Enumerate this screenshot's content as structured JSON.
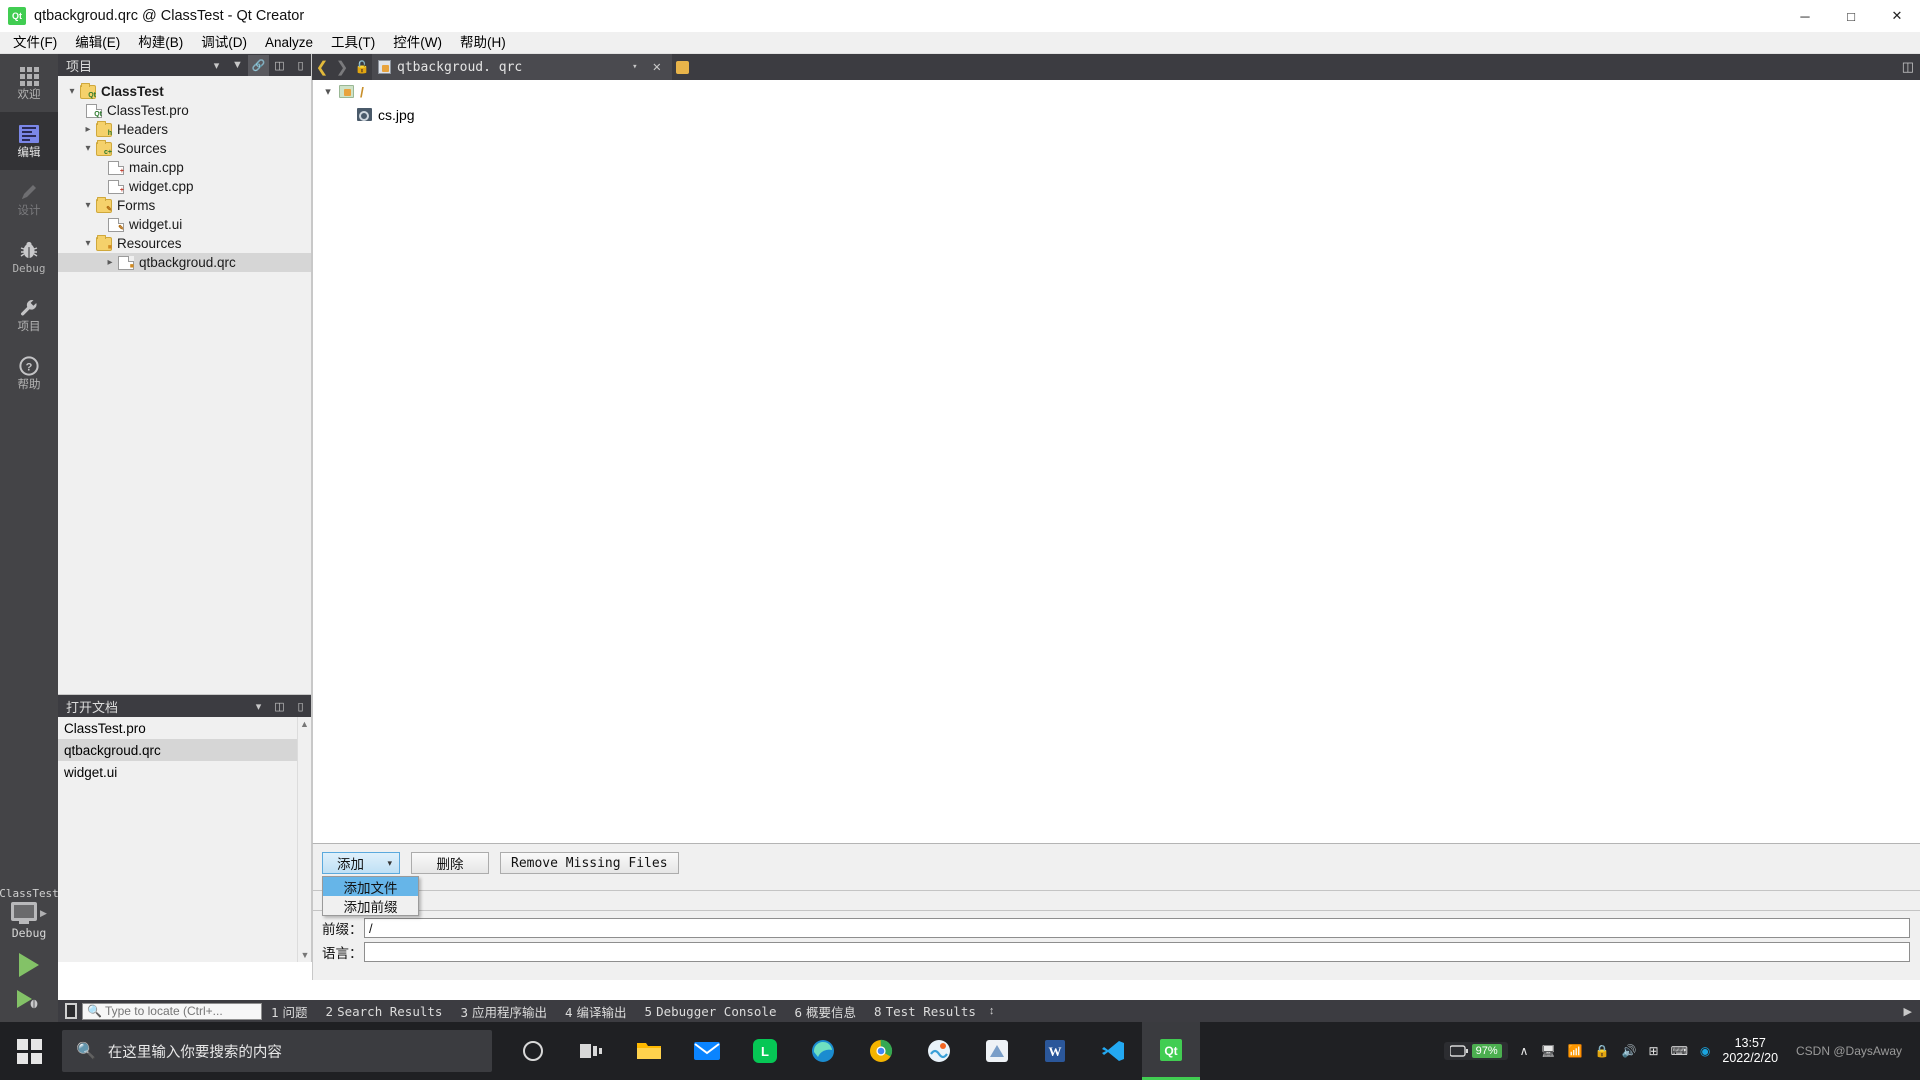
{
  "window": {
    "title": "qtbackgroud.qrc @ ClassTest - Qt Creator",
    "app_icon": "qt-icon",
    "minimize": "─",
    "maximize": "□",
    "close": "✕"
  },
  "menubar": {
    "items": [
      {
        "label": "文件(F)",
        "mnemonic": "F"
      },
      {
        "label": "编辑(E)",
        "mnemonic": "E"
      },
      {
        "label": "构建(B)",
        "mnemonic": "B"
      },
      {
        "label": "调试(D)",
        "mnemonic": "D"
      },
      {
        "label": "Analyze",
        "mnemonic": "A"
      },
      {
        "label": "工具(T)",
        "mnemonic": "T"
      },
      {
        "label": "控件(W)",
        "mnemonic": "W"
      },
      {
        "label": "帮助(H)",
        "mnemonic": "H"
      }
    ]
  },
  "modebar": {
    "items": [
      {
        "label": "欢迎",
        "icon": "grid-icon",
        "state": "normal"
      },
      {
        "label": "编辑",
        "icon": "editor-icon",
        "state": "selected"
      },
      {
        "label": "设计",
        "icon": "pencil-icon",
        "state": "disabled"
      },
      {
        "label": "Debug",
        "icon": "bug-icon",
        "state": "normal"
      },
      {
        "label": "项目",
        "icon": "wrench-icon",
        "state": "normal"
      },
      {
        "label": "帮助",
        "icon": "question-icon",
        "state": "normal"
      }
    ]
  },
  "kit_selector": {
    "project": "ClassTest",
    "build_config": "Debug",
    "run_label": "run-button",
    "debug_label": "debug-button",
    "build_label": "build-button"
  },
  "project_panel": {
    "title": "项目",
    "tree": [
      {
        "label": "ClassTest",
        "icon": "qt-project-icon",
        "indent": 0,
        "chevron": "down",
        "bold": true
      },
      {
        "label": "ClassTest.pro",
        "icon": "pro-file-icon",
        "indent": 1,
        "chevron": "none"
      },
      {
        "label": "Headers",
        "icon": "folder-h-icon",
        "indent": 1,
        "chevron": "right"
      },
      {
        "label": "Sources",
        "icon": "folder-cpp-icon",
        "indent": 1,
        "chevron": "down"
      },
      {
        "label": "main.cpp",
        "icon": "cpp-file-icon",
        "indent": 2,
        "chevron": "none"
      },
      {
        "label": "widget.cpp",
        "icon": "cpp-file-icon",
        "indent": 2,
        "chevron": "none"
      },
      {
        "label": "Forms",
        "icon": "folder-ui-icon",
        "indent": 1,
        "chevron": "down"
      },
      {
        "label": "widget.ui",
        "icon": "ui-file-icon",
        "indent": 2,
        "chevron": "none"
      },
      {
        "label": "Resources",
        "icon": "folder-qrc-icon",
        "indent": 1,
        "chevron": "down"
      },
      {
        "label": "qtbackgroud.qrc",
        "icon": "qrc-file-icon",
        "indent": 2,
        "chevron": "right",
        "selected": true
      }
    ]
  },
  "open_documents": {
    "title": "打开文档",
    "items": [
      {
        "label": "ClassTest.pro",
        "selected": false
      },
      {
        "label": "qtbackgroud.qrc",
        "selected": true
      },
      {
        "label": "widget.ui",
        "selected": false
      }
    ]
  },
  "editor_tabbar": {
    "back": "❮",
    "forward": "❯",
    "lock_icon": "unlocked-icon",
    "tab": {
      "label": "qtbackgroud. qrc",
      "icon": "qrc-file-icon"
    },
    "dropdown": "▾",
    "close": "✕",
    "split_icon": "split-editor-icon"
  },
  "resource_editor": {
    "rows": [
      {
        "label": "/",
        "icon": "prefix-folder-icon",
        "indent": 0,
        "chevron": "down"
      },
      {
        "label": "cs.jpg",
        "icon": "image-file-icon",
        "indent": 1,
        "chevron": "none"
      }
    ]
  },
  "resource_bottom": {
    "buttons": {
      "add": "添加",
      "add_caret": "▾",
      "remove": "删除",
      "remove_missing": "Remove Missing Files"
    },
    "menu": {
      "items": [
        {
          "label": "添加文件",
          "highlighted": true
        },
        {
          "label": "添加前缀",
          "highlighted": false
        }
      ]
    },
    "fields": [
      {
        "label": "前缀：",
        "value": "/",
        "placeholder": ""
      },
      {
        "label": "语言：",
        "value": "",
        "placeholder": ""
      }
    ]
  },
  "statusbar": {
    "locator_icon": "locator-icon",
    "search_icon": "search-icon",
    "locator_placeholder": "Type to locate (Ctrl+...",
    "output_tabs": [
      {
        "num": "1",
        "label": "问题"
      },
      {
        "num": "2",
        "label": "Search Results"
      },
      {
        "num": "3",
        "label": "应用程序输出"
      },
      {
        "num": "4",
        "label": "编译输出"
      },
      {
        "num": "5",
        "label": "Debugger Console"
      },
      {
        "num": "6",
        "label": "概要信息"
      },
      {
        "num": "8",
        "label": "Test Results"
      }
    ],
    "updown": "↕"
  },
  "taskbar": {
    "start_icon": "windows-start-icon",
    "search_icon": "search-icon",
    "search_placeholder": "在这里输入你要搜索的内容",
    "apps": [
      {
        "name": "cortana-icon",
        "color": "#d8d8d8"
      },
      {
        "name": "task-view-icon",
        "color": "#d8d8d8"
      },
      {
        "name": "file-explorer-icon",
        "color": "#ffb900"
      },
      {
        "name": "mail-icon",
        "color": "#0a84ff"
      },
      {
        "name": "line-icon",
        "color": "#06c755"
      },
      {
        "name": "edge-icon",
        "color": "#0a7cc0"
      },
      {
        "name": "chrome-icon",
        "color": "#34a853"
      },
      {
        "name": "ocean-app-icon",
        "color": "#4aa8d8"
      },
      {
        "name": "pinned-app-icon",
        "color": "#7a9ec8"
      },
      {
        "name": "word-icon",
        "color": "#2b579a"
      },
      {
        "name": "vscode-icon",
        "color": "#23a9f2"
      },
      {
        "name": "qtcreator-icon",
        "color": "#41cd52"
      }
    ],
    "tray": {
      "battery_pct": "97%",
      "chevron": "∧",
      "icons": [
        "screen-icon",
        "wifi-icon",
        "lock-icon",
        "volume-icon",
        "usb-icon",
        "keyboard-icon",
        "qq-icon"
      ],
      "time": "13:57",
      "date": "2022/2/20",
      "watermark": "CSDN @DaysAway"
    }
  }
}
